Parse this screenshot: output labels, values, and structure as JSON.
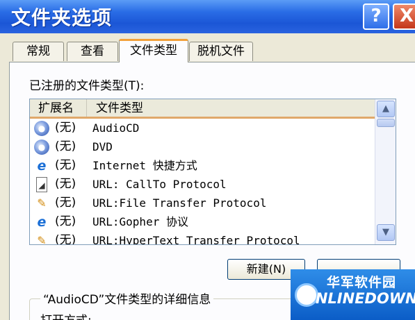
{
  "window": {
    "title": "文件夹选项",
    "help": "?",
    "close": "X"
  },
  "tabs": [
    {
      "label": "常规"
    },
    {
      "label": "查看"
    },
    {
      "label": "文件类型"
    },
    {
      "label": "脱机文件"
    }
  ],
  "registered_label": "已注册的文件类型(T):",
  "list": {
    "columns": [
      "扩展名",
      "文件类型"
    ],
    "rows": [
      {
        "ext": "(无)",
        "type": "AudioCD",
        "icon": "cd-icon"
      },
      {
        "ext": "(无)",
        "type": "DVD",
        "icon": "cd-icon"
      },
      {
        "ext": "(无)",
        "type": "Internet 快捷方式",
        "icon": "ie-icon"
      },
      {
        "ext": "(无)",
        "type": "URL: CallTo Protocol",
        "icon": "document-icon"
      },
      {
        "ext": "(无)",
        "type": "URL:File Transfer Protocol",
        "icon": "ftp-icon"
      },
      {
        "ext": "(无)",
        "type": "URL:Gopher 协议",
        "icon": "ie-icon"
      },
      {
        "ext": "(无)",
        "type": "URL:HyperText Transfer Protocol",
        "icon": "ftp-icon"
      }
    ]
  },
  "buttons": {
    "new": "新建(N)",
    "delete": ""
  },
  "details": {
    "title": "“AudioCD”文件类型的详细信息",
    "opens_with": "打开方式:"
  },
  "watermark": {
    "cn": "华军软件园",
    "en": "ONLINEDOWN.net"
  }
}
